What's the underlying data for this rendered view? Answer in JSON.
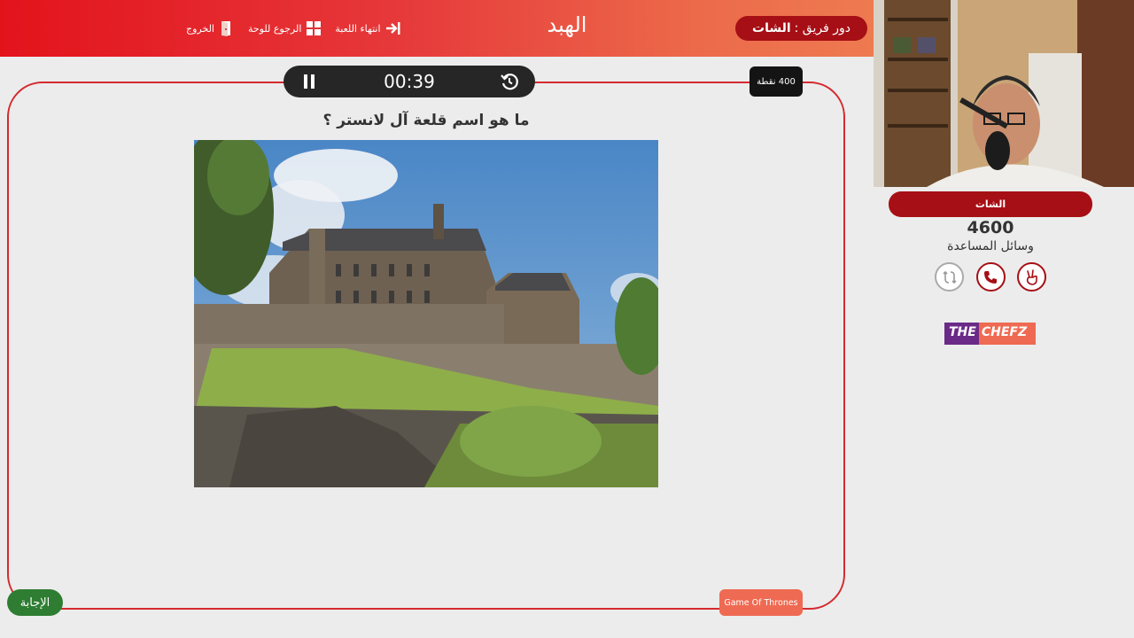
{
  "header": {
    "turn_label": "دور فريق :",
    "turn_team": "الشات",
    "title": "الهبد",
    "nav": {
      "end_game": "انتهاء اللعبة",
      "back_to_board": "الرجوع للوحة",
      "exit": "الخروج"
    },
    "colors": {
      "primary": "#e3131c",
      "accent": "#ee7a50",
      "dark_red": "#a60f15"
    }
  },
  "question_panel": {
    "timer": "00:39",
    "points": "400 نقطة",
    "question": "ما هو اسم قلعة آل لانستر ؟",
    "answer_button": "الإجابة",
    "category": "Game Of Thrones"
  },
  "team_panel": {
    "team_name": "الشات",
    "score": "4600",
    "aids_title": "وسائل المساعدة",
    "aids": [
      {
        "icon": "two-fingers-hand-icon",
        "state": "available"
      },
      {
        "icon": "phone-icon",
        "state": "available"
      },
      {
        "icon": "swap-icon",
        "state": "used"
      }
    ]
  },
  "logo": {
    "part1": "THE",
    "part2": "CHEFZ"
  }
}
